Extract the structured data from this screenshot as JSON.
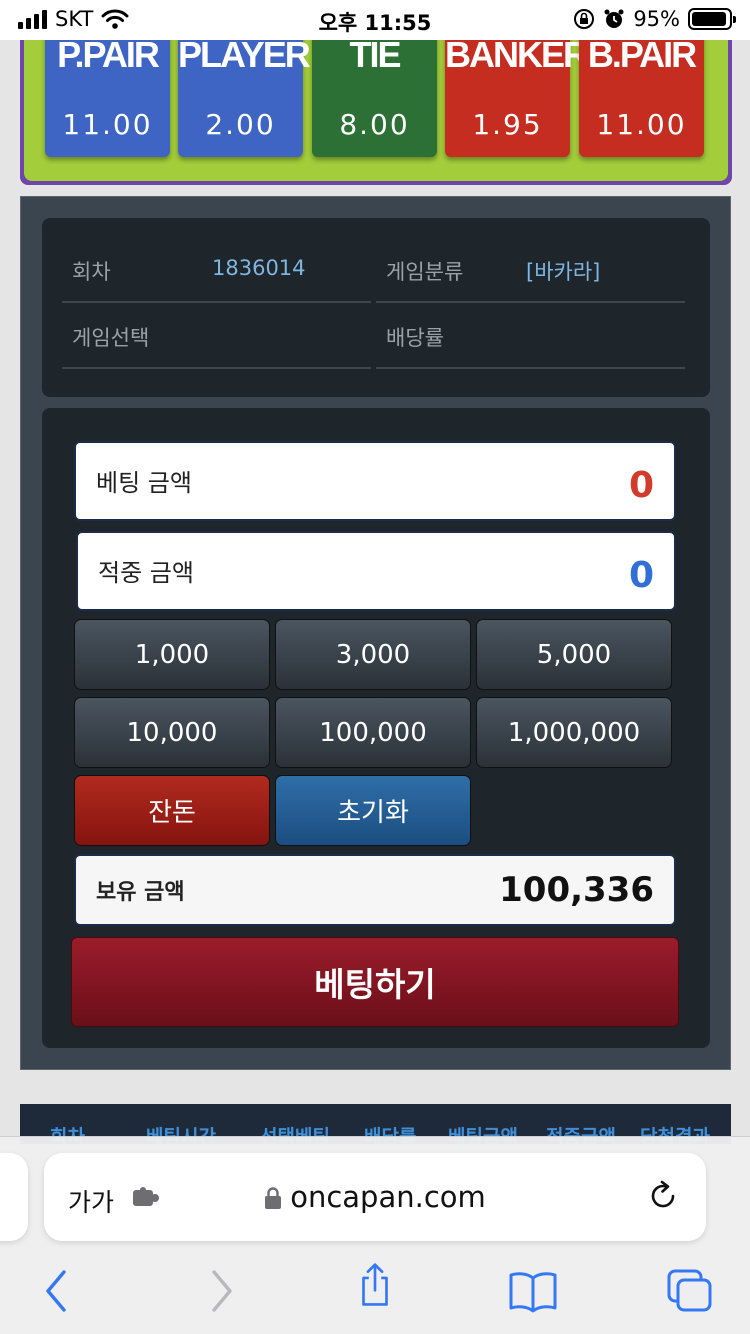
{
  "status_bar": {
    "carrier": "SKT",
    "time": "오후 11:55",
    "battery": "95%",
    "battery_level": 0.95
  },
  "odds": [
    {
      "name": "P.PAIR",
      "value": "11.00",
      "color": "#3e64c4"
    },
    {
      "name": "PLAYER",
      "value": "2.00",
      "color": "#3e64c4"
    },
    {
      "name": "TIE",
      "value": "8.00",
      "color": "#2c7035"
    },
    {
      "name": "BANKER",
      "value": "1.95",
      "color": "#c42d20"
    },
    {
      "name": "B.PAIR",
      "value": "11.00",
      "color": "#c42d20"
    }
  ],
  "info": {
    "round_label": "회차",
    "round_value": "1836014",
    "category_label": "게임분류",
    "category_value": "[바카라]",
    "selection_label": "게임선택",
    "odds_label": "배당률"
  },
  "bet": {
    "bet_amount_label": "베팅 금액",
    "bet_amount_value": "0",
    "win_amount_label": "적중 금액",
    "win_amount_value": "0",
    "chips": [
      "1,000",
      "3,000",
      "5,000",
      "10,000",
      "100,000",
      "1,000,000"
    ],
    "all_in_label": "잔돈",
    "reset_label": "초기화",
    "balance_label": "보유 금액",
    "balance_value": "100,336",
    "submit_label": "베팅하기"
  },
  "history_headers": [
    "회차",
    "베팅시간",
    "선택베팅",
    "배당률",
    "베팅금액",
    "적중금액",
    "당첨결과"
  ],
  "browser": {
    "aa_label": "가가",
    "url": "oncapan.com"
  }
}
